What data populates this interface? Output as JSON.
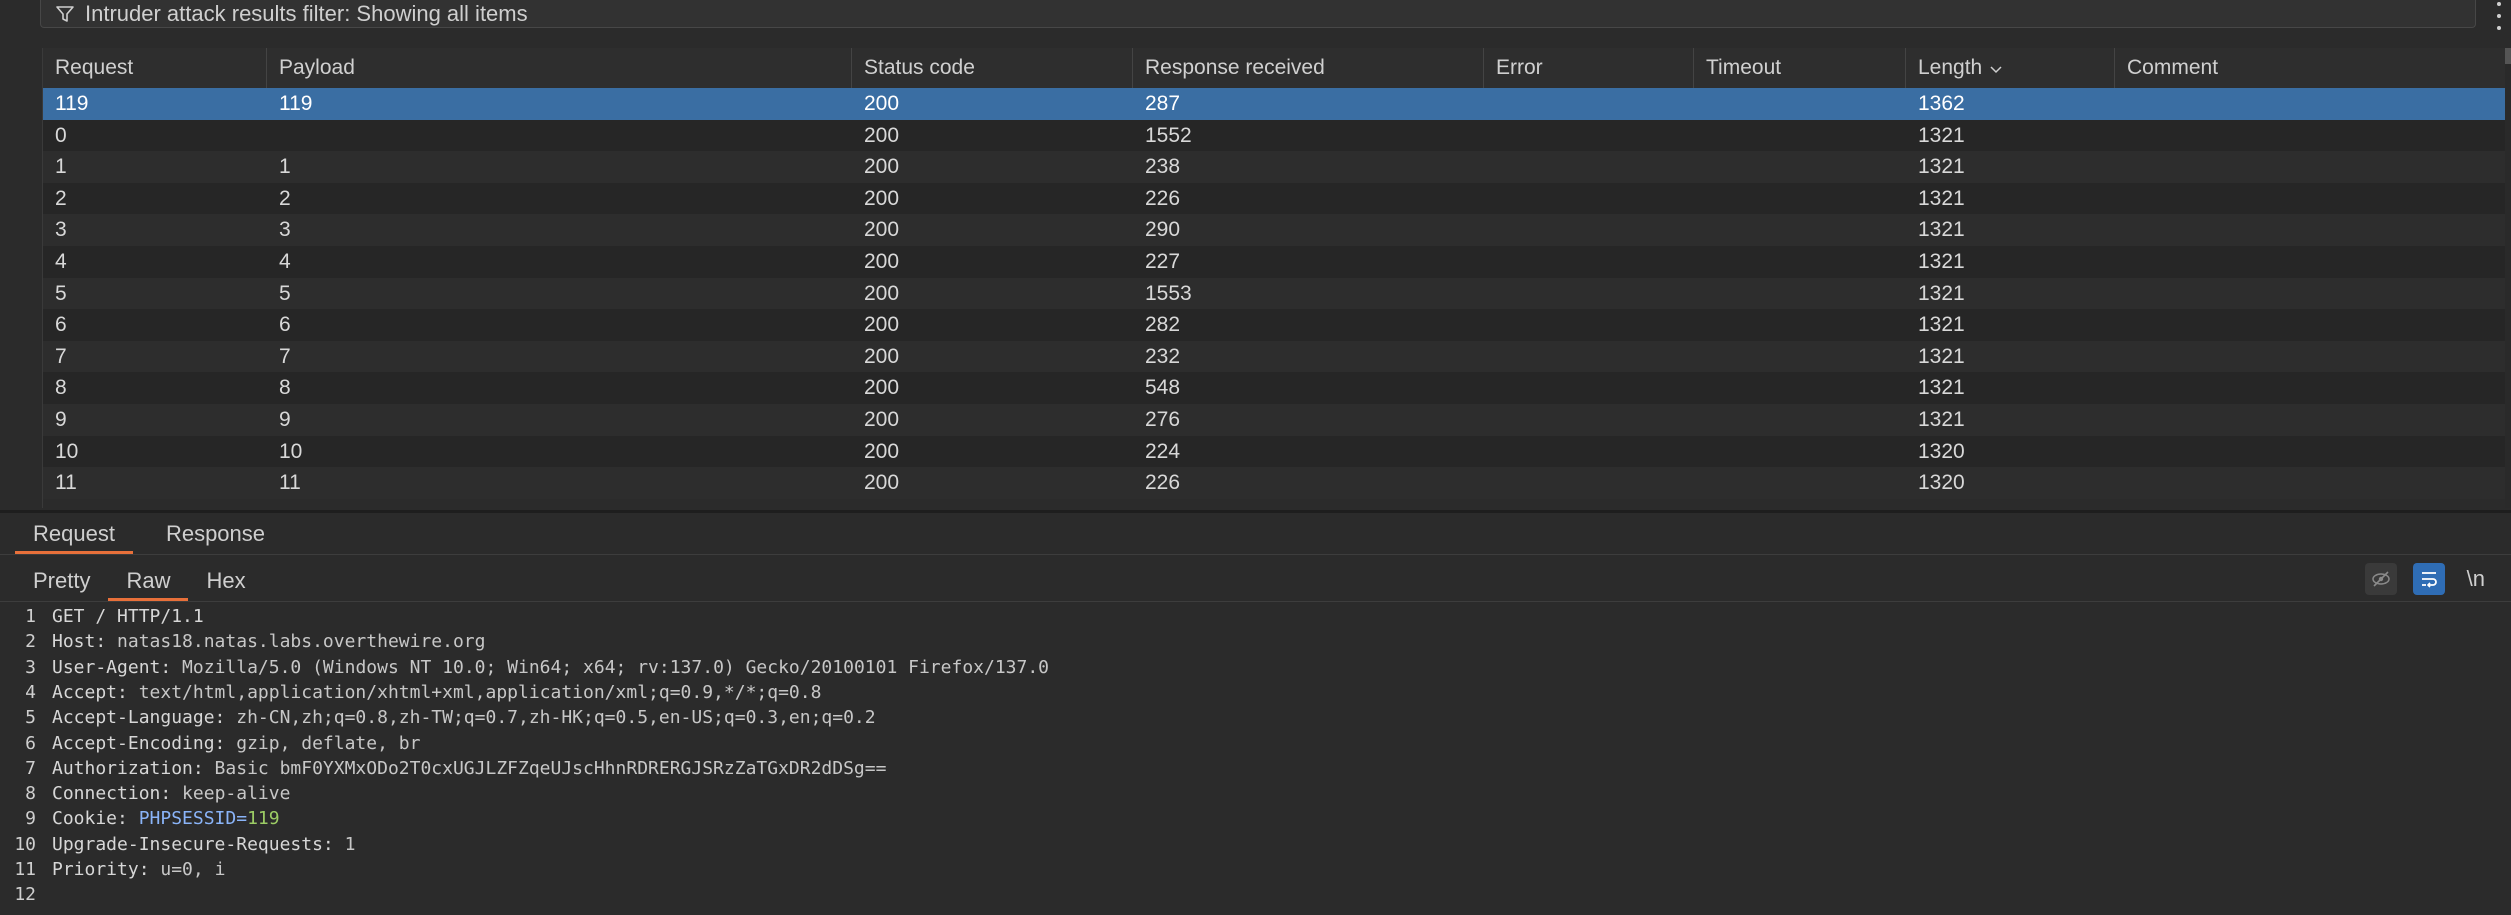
{
  "filter": {
    "text": "Intruder attack results filter: Showing all items",
    "icon": "filter-icon"
  },
  "table": {
    "columns": [
      "Request",
      "Payload",
      "Status code",
      "Response received",
      "Error",
      "Timeout",
      "Length",
      "Comment"
    ],
    "sorted_column": "Length",
    "selected_row_index": 0,
    "rows": [
      [
        "119",
        "119",
        "200",
        "287",
        "",
        "",
        "1362",
        ""
      ],
      [
        "0",
        "",
        "200",
        "1552",
        "",
        "",
        "1321",
        ""
      ],
      [
        "1",
        "1",
        "200",
        "238",
        "",
        "",
        "1321",
        ""
      ],
      [
        "2",
        "2",
        "200",
        "226",
        "",
        "",
        "1321",
        ""
      ],
      [
        "3",
        "3",
        "200",
        "290",
        "",
        "",
        "1321",
        ""
      ],
      [
        "4",
        "4",
        "200",
        "227",
        "",
        "",
        "1321",
        ""
      ],
      [
        "5",
        "5",
        "200",
        "1553",
        "",
        "",
        "1321",
        ""
      ],
      [
        "6",
        "6",
        "200",
        "282",
        "",
        "",
        "1321",
        ""
      ],
      [
        "7",
        "7",
        "200",
        "232",
        "",
        "",
        "1321",
        ""
      ],
      [
        "8",
        "8",
        "200",
        "548",
        "",
        "",
        "1321",
        ""
      ],
      [
        "9",
        "9",
        "200",
        "276",
        "",
        "",
        "1321",
        ""
      ],
      [
        "10",
        "10",
        "200",
        "224",
        "",
        "",
        "1320",
        ""
      ],
      [
        "11",
        "11",
        "200",
        "226",
        "",
        "",
        "1320",
        ""
      ]
    ]
  },
  "message_tabs": {
    "request": "Request",
    "response": "Response",
    "active": "Request"
  },
  "view_tabs": {
    "pretty": "Pretty",
    "raw": "Raw",
    "hex": "Hex",
    "active": "Raw"
  },
  "toolbar": {
    "newline_label": "\\n"
  },
  "colors": {
    "selected_row": "#3a6ea3",
    "tab_underline": "#e8703a",
    "toggle_on": "#2f6db5",
    "cookie_value": "#9ccc65"
  },
  "request_lines": [
    {
      "n": "1",
      "key": "GET / HTTP/1.1",
      "value": ""
    },
    {
      "n": "2",
      "key": "Host:",
      "value": " natas18.natas.labs.overthewire.org"
    },
    {
      "n": "3",
      "key": "User-Agent:",
      "value": " Mozilla/5.0 (Windows NT 10.0; Win64; x64; rv:137.0) Gecko/20100101 Firefox/137.0"
    },
    {
      "n": "4",
      "key": "Accept:",
      "value": " text/html,application/xhtml+xml,application/xml;q=0.9,*/*;q=0.8"
    },
    {
      "n": "5",
      "key": "Accept-Language:",
      "value": " zh-CN,zh;q=0.8,zh-TW;q=0.7,zh-HK;q=0.5,en-US;q=0.3,en;q=0.2"
    },
    {
      "n": "6",
      "key": "Accept-Encoding:",
      "value": " gzip, deflate, br"
    },
    {
      "n": "7",
      "key": "Authorization:",
      "value": " Basic bmF0YXMxODo2T0cxUGJLZFZqeUJscHhnRDRERGJSRzZaTGxDR2dDSg=="
    },
    {
      "n": "8",
      "key": "Connection:",
      "value": " keep-alive"
    },
    {
      "n": "9",
      "key": "Cookie:",
      "value": "",
      "cookie_name": " PHPSESSID=",
      "cookie_value": "119"
    },
    {
      "n": "10",
      "key": "Upgrade-Insecure-Requests:",
      "value": " 1"
    },
    {
      "n": "11",
      "key": "Priority:",
      "value": " u=0, i"
    },
    {
      "n": "12",
      "key": "",
      "value": ""
    }
  ]
}
